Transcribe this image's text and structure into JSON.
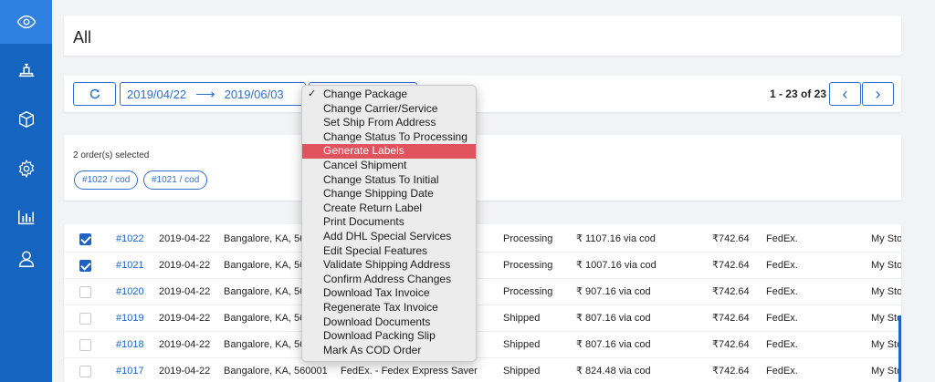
{
  "sidebar": {
    "items": [
      {
        "icon": "eye-icon"
      },
      {
        "icon": "scale-icon"
      },
      {
        "icon": "box-icon"
      },
      {
        "icon": "gear-icon"
      },
      {
        "icon": "bar-chart-icon"
      },
      {
        "icon": "user-icon"
      }
    ],
    "active_color": "#2f80e0",
    "bg_color": "#1565c0"
  },
  "header": {
    "title": "All"
  },
  "toolbar": {
    "refresh_icon": "refresh-icon",
    "date_from": "2019/04/22",
    "date_arrow": "⟶",
    "date_to": "2019/06/03",
    "pager": "1 - 23 of 23",
    "prev_label": "‹",
    "next_label": "›"
  },
  "selection": {
    "summary": "2 order(s) selected",
    "tags": [
      "#1022 / cod",
      "#1021 / cod"
    ]
  },
  "menu": {
    "checked_index": 0,
    "highlighted_index": 4,
    "items": [
      "Change Package",
      "Change Carrier/Service",
      "Set Ship From Address",
      "Change Status To Processing",
      "Generate Labels",
      "Cancel Shipment",
      "Change Status To Initial",
      "Change Shipping Date",
      "Create Return Label",
      "Print Documents",
      "Add DHL Special Services",
      "Edit Special Features",
      "Validate Shipping Address",
      "Confirm Address Changes",
      "Download Tax Invoice",
      "Regenerate Tax Invoice",
      "Download Documents",
      "Download Packing Slip",
      "Mark As COD Order"
    ],
    "highlight_color": "#e0525c"
  },
  "table": {
    "rows": [
      {
        "checked": true,
        "order": "#1022",
        "date": "2019-04-22",
        "address": "Bangalore, KA, 56",
        "service": "",
        "status": "Processing",
        "amount": "₹ 1107.16 via cod",
        "cost": "₹742.64",
        "carrier": "FedEx.",
        "store": "My Sto"
      },
      {
        "checked": true,
        "order": "#1021",
        "date": "2019-04-22",
        "address": "Bangalore, KA, 56",
        "service": "",
        "status": "Processing",
        "amount": "₹ 1007.16 via cod",
        "cost": "₹742.64",
        "carrier": "FedEx.",
        "store": "My Sto"
      },
      {
        "checked": false,
        "order": "#1020",
        "date": "2019-04-22",
        "address": "Bangalore, KA, 56",
        "service": "",
        "status": "Processing",
        "amount": "₹ 907.16 via cod",
        "cost": "₹742.64",
        "carrier": "FedEx.",
        "store": "My Sto"
      },
      {
        "checked": false,
        "order": "#1019",
        "date": "2019-04-22",
        "address": "Bangalore, KA, 56",
        "service": "",
        "status": "Shipped",
        "amount": "₹ 807.16 via cod",
        "cost": "₹742.64",
        "carrier": "FedEx.",
        "store": "My Sto"
      },
      {
        "checked": false,
        "order": "#1018",
        "date": "2019-04-22",
        "address": "Bangalore, KA, 56",
        "service": "",
        "status": "Shipped",
        "amount": "₹ 807.16 via cod",
        "cost": "₹742.64",
        "carrier": "FedEx.",
        "store": "My Sto"
      },
      {
        "checked": false,
        "order": "#1017",
        "date": "2019-04-22",
        "address": "Bangalore, KA, 560001",
        "service": "FedEx. - Fedex Express Saver",
        "status": "Shipped",
        "amount": "₹ 824.48 via cod",
        "cost": "₹742.64",
        "carrier": "FedEx.",
        "store": "My Sto"
      }
    ]
  }
}
